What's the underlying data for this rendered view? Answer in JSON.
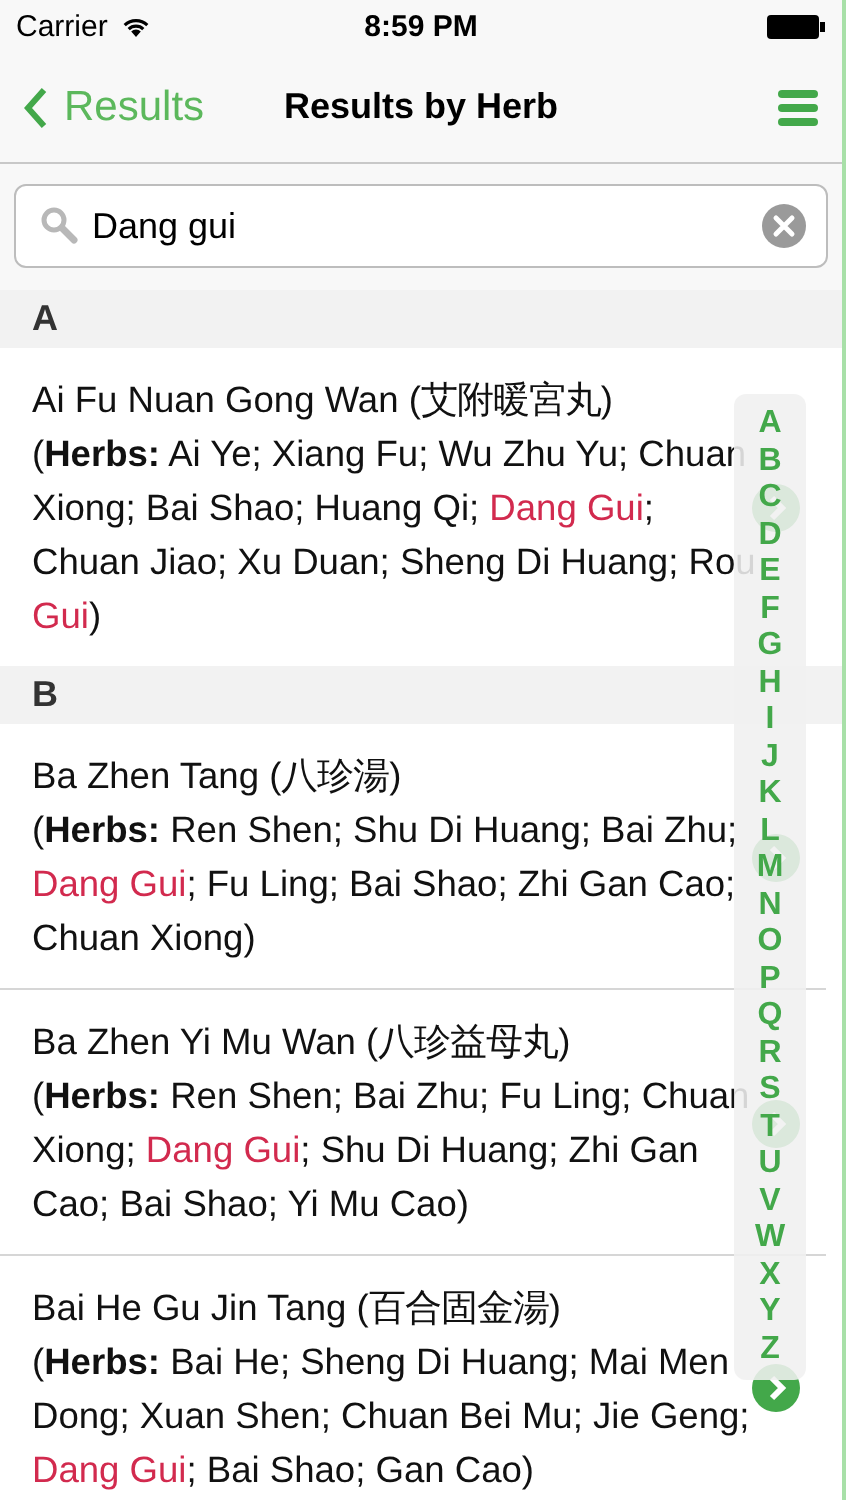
{
  "status_bar": {
    "carrier": "Carrier",
    "time": "8:59 PM"
  },
  "nav": {
    "back": "Results",
    "title": "Results by Herb"
  },
  "search": {
    "value": "Dang gui"
  },
  "sections": [
    {
      "letter": "A",
      "rows": [
        {
          "name": "Ai Fu Nuan Gong Wan (艾附暖宮丸)",
          "herbs": [
            {
              "kind": "plain",
              "text": "("
            },
            {
              "kind": "bold",
              "text": "Herbs:"
            },
            {
              "kind": "plain",
              "text": " Ai Ye; Xiang Fu; Wu Zhu Yu; Chuan Xiong; Bai Shao; Huang Qi; "
            },
            {
              "kind": "match",
              "text": "Dang Gui"
            },
            {
              "kind": "plain",
              "text": "; Chuan Jiao; Xu Duan; Sheng Di Huang; Rou "
            },
            {
              "kind": "match",
              "text": "Gui"
            },
            {
              "kind": "plain",
              "text": ")"
            }
          ]
        }
      ]
    },
    {
      "letter": "B",
      "rows": [
        {
          "name": "Ba Zhen Tang (八珍湯)",
          "herbs": [
            {
              "kind": "plain",
              "text": "("
            },
            {
              "kind": "bold",
              "text": "Herbs:"
            },
            {
              "kind": "plain",
              "text": " Ren Shen; Shu Di Huang; Bai Zhu; "
            },
            {
              "kind": "match",
              "text": "Dang Gui"
            },
            {
              "kind": "plain",
              "text": "; Fu Ling; Bai Shao; Zhi Gan Cao; Chuan Xiong)"
            }
          ]
        },
        {
          "name": "Ba Zhen Yi Mu Wan (八珍益母丸)",
          "herbs": [
            {
              "kind": "plain",
              "text": "("
            },
            {
              "kind": "bold",
              "text": "Herbs:"
            },
            {
              "kind": "plain",
              "text": " Ren Shen; Bai Zhu; Fu Ling; Chuan Xiong; "
            },
            {
              "kind": "match",
              "text": "Dang Gui"
            },
            {
              "kind": "plain",
              "text": "; Shu Di Huang; Zhi Gan Cao; Bai Shao; Yi Mu Cao)"
            }
          ]
        },
        {
          "name": "Bai He Gu Jin Tang (百合固金湯)",
          "herbs": [
            {
              "kind": "plain",
              "text": "("
            },
            {
              "kind": "bold",
              "text": "Herbs:"
            },
            {
              "kind": "plain",
              "text": " Bai He; Sheng Di Huang; Mai Men Dong; Xuan Shen; Chuan Bei Mu; Jie Geng; "
            },
            {
              "kind": "match",
              "text": "Dang Gui"
            },
            {
              "kind": "plain",
              "text": "; Bai Shao; Gan Cao)"
            }
          ]
        }
      ]
    }
  ],
  "index": [
    "A",
    "B",
    "C",
    "D",
    "E",
    "F",
    "G",
    "H",
    "I",
    "J",
    "K",
    "L",
    "M",
    "N",
    "O",
    "P",
    "Q",
    "R",
    "S",
    "T",
    "U",
    "V",
    "W",
    "X",
    "Y",
    "Z"
  ]
}
